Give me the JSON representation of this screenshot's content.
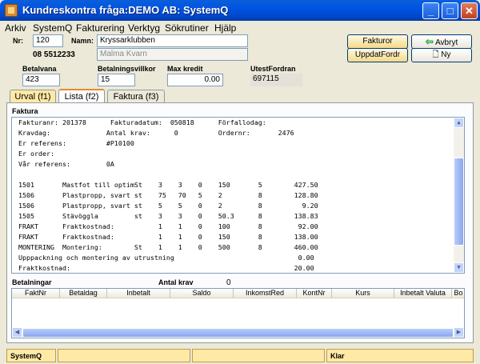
{
  "window": {
    "title": "Kundreskontra fråga:DEMO AB: SystemQ",
    "min": "_",
    "max": "□",
    "close": "✕"
  },
  "menu": [
    "Arkiv",
    "SystemQ",
    "Fakturering",
    "Verktyg",
    "Sökrutiner",
    "Hjälp"
  ],
  "customer": {
    "nr_label": "Nr:",
    "nr_value": "120",
    "phone": "08 5512233",
    "namn_label": "Namn:",
    "namn_value": "Kryssarklubben",
    "namn2_value": "Malma Kvarn"
  },
  "buttons": {
    "fakturor": "Fakturor",
    "avbryt": "Avbryt",
    "uppdat": "UppdatFordr",
    "ny": "Ny"
  },
  "fields": {
    "betalvana_label": "Betalvana",
    "betalvana_value": "423",
    "villkor_label": "Betalningsvillkor",
    "villkor_value": "15",
    "kredit_label": "Max kredit",
    "kredit_value": "0.00",
    "utest_label": "UtestFordran",
    "utest_value": "697115"
  },
  "tabs": [
    "Urval (f1)",
    "Lista (f2)",
    "Faktura (f3)"
  ],
  "faktura": {
    "title": "Faktura",
    "lines": [
      "Fakturanr: 201378      Fakturadatum:  050818      Förfallodag:",
      "Kravdag:              Antal krav:      0          Ordernr:       2476",
      "Er referens:          #P10100",
      "Er order:",
      "Vår referens:         0A",
      "",
      "1501       Mastfot till optimSt    3    3    0    150       5        427.50",
      "1506       Plastpropp, svart st    75   70   5    2         8        128.80",
      "1506       Plastpropp, svart st    5    5    0    2         8          9.20",
      "1505       Stävöggla         st    3    3    0    50.3      8        138.83",
      "FRAKT      Fraktkostnad:           1    1    0    100       8         92.00",
      "FRAKT      Fraktkostnad:           1    1    0    150       8        138.00",
      "MONTERING  Montering:        St    1    1    0    500       8        460.00",
      "Upppackning och montering av utrustning                               0.00",
      "Fraktkostnad:                                                        20.00"
    ]
  },
  "betalningar": {
    "title": "Betalningar",
    "antal_label": "Antal krav",
    "antal_value": "0",
    "columns": [
      "FaktNr",
      "Betaldag",
      "Inbetalt",
      "Saldo",
      "InkomstRed",
      "KontNr",
      "Kurs",
      "Inbetalt Valuta",
      "Bo"
    ]
  },
  "status": {
    "left": "SystemQ",
    "right": "Klar"
  }
}
